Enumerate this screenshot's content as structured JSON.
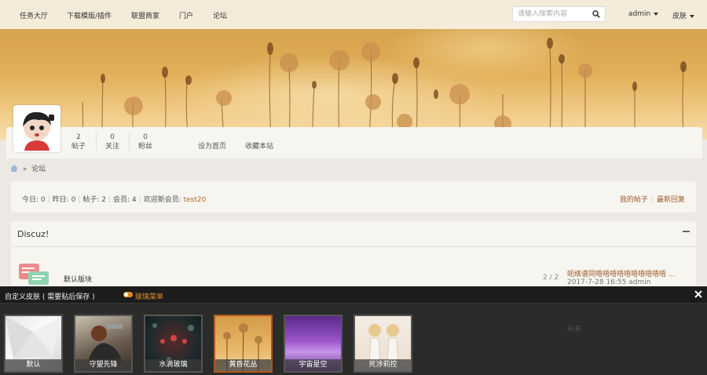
{
  "nav": {
    "items": [
      "任务大厅",
      "下载模版/插件",
      "联盟商家",
      "门户",
      "论坛"
    ],
    "search_placeholder": "请输入搜索内容",
    "user": "admin",
    "skin": "皮肤"
  },
  "profile": {
    "stats": [
      {
        "num": "2",
        "label": "帖子"
      },
      {
        "num": "0",
        "label": "关注"
      },
      {
        "num": "0",
        "label": "粉丝"
      }
    ],
    "links": [
      "设为首页",
      "收藏本站"
    ]
  },
  "breadcrumb": {
    "sep": "»",
    "current": "论坛"
  },
  "stats_bar": {
    "today": "今日: 0",
    "yesterday": "昨日: 0",
    "posts": "帖子: 2",
    "members": "会员: 4",
    "welcome": "欢迎新会员:",
    "new_member": "test20",
    "my_posts": "我的帖子",
    "latest": "最新回复"
  },
  "forum": {
    "title": "Discuz!",
    "board_name": "默认版块",
    "count": "2 / 2",
    "last_post": "呃络谱同唔唔唔唔唔唔唔唔唔唔 ...",
    "last_time": "2017-7-28 16:55 admin"
  },
  "skin_panel": {
    "title": "自定义皮肤 ( 需要贴后保存 )",
    "toggle_label": "玻璃菜单",
    "skins": [
      "默认",
      "守望先锋",
      "水滴玻璃",
      "黄昏花丛",
      "宇宙星空",
      "死渉莉控"
    ],
    "active_skin": "黄昏花丛",
    "behind_text": "从来"
  },
  "colors": {
    "accent": "#e08a2a",
    "link": "#9a5a2a"
  }
}
